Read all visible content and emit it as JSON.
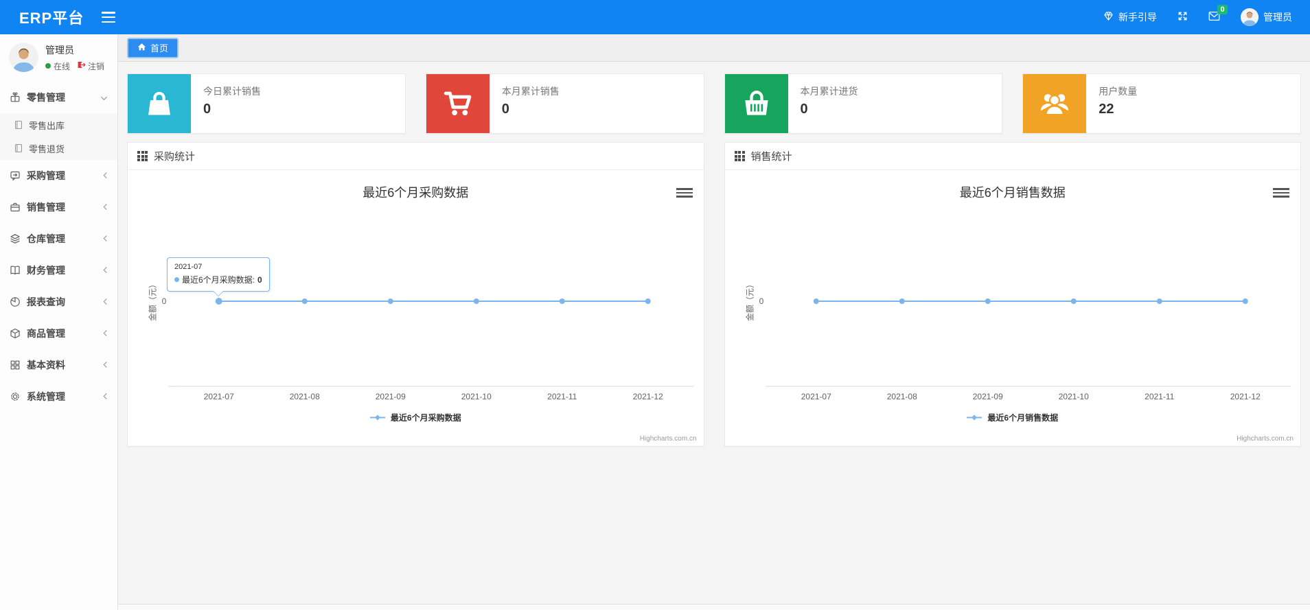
{
  "navbar": {
    "brand": "ERP平台",
    "guide_label": "新手引导",
    "mail_badge": "0",
    "username": "管理员",
    "bar_color": "#0f84f2",
    "badge_color": "#19be6b"
  },
  "user_panel": {
    "name": "管理员",
    "status_label": "在线",
    "logout_label": "注销"
  },
  "sidebar": {
    "items": [
      {
        "label": "零售管理",
        "expanded": true,
        "children": [
          {
            "label": "零售出库"
          },
          {
            "label": "零售退货"
          }
        ]
      },
      {
        "label": "采购管理",
        "expanded": false
      },
      {
        "label": "销售管理",
        "expanded": false
      },
      {
        "label": "仓库管理",
        "expanded": false
      },
      {
        "label": "财务管理",
        "expanded": false
      },
      {
        "label": "报表查询",
        "expanded": false
      },
      {
        "label": "商品管理",
        "expanded": false
      },
      {
        "label": "基本资料",
        "expanded": false
      },
      {
        "label": "系统管理",
        "expanded": false
      }
    ]
  },
  "tabs": {
    "home_label": "首页"
  },
  "stat_cards": [
    {
      "label": "今日累计销售",
      "value": "0",
      "color": "#29b7d3",
      "icon": "shopping-bag"
    },
    {
      "label": "本月累计销售",
      "value": "0",
      "color": "#e0473a",
      "icon": "shopping-cart"
    },
    {
      "label": "本月累计进货",
      "value": "0",
      "color": "#17a45c",
      "icon": "shopping-basket"
    },
    {
      "label": "用户数量",
      "value": "22",
      "color": "#f0a325",
      "icon": "users"
    }
  ],
  "panels": [
    {
      "header": "采购统计"
    },
    {
      "header": "销售统计"
    }
  ],
  "chart_data": [
    {
      "type": "line",
      "title": "最近6个月采购数据",
      "categories": [
        "2021-07",
        "2021-08",
        "2021-09",
        "2021-10",
        "2021-11",
        "2021-12"
      ],
      "series": [
        {
          "name": "最近6个月采购数据",
          "values": [
            0,
            0,
            0,
            0,
            0,
            0
          ]
        }
      ],
      "ylabel": "金额（元）",
      "yticks": [
        "0"
      ],
      "line_color": "#7cb5ec",
      "grid": false,
      "legend_position": "bottom",
      "tooltip": {
        "visible": true,
        "category": "2021-07",
        "label": "最近6个月采购数据:",
        "value": "0"
      }
    },
    {
      "type": "line",
      "title": "最近6个月销售数据",
      "categories": [
        "2021-07",
        "2021-08",
        "2021-09",
        "2021-10",
        "2021-11",
        "2021-12"
      ],
      "series": [
        {
          "name": "最近6个月销售数据",
          "values": [
            0,
            0,
            0,
            0,
            0,
            0
          ]
        }
      ],
      "ylabel": "金额（元）",
      "yticks": [
        "0"
      ],
      "line_color": "#7cb5ec",
      "grid": false,
      "legend_position": "bottom"
    }
  ],
  "credits": "Highcharts.com.cn"
}
